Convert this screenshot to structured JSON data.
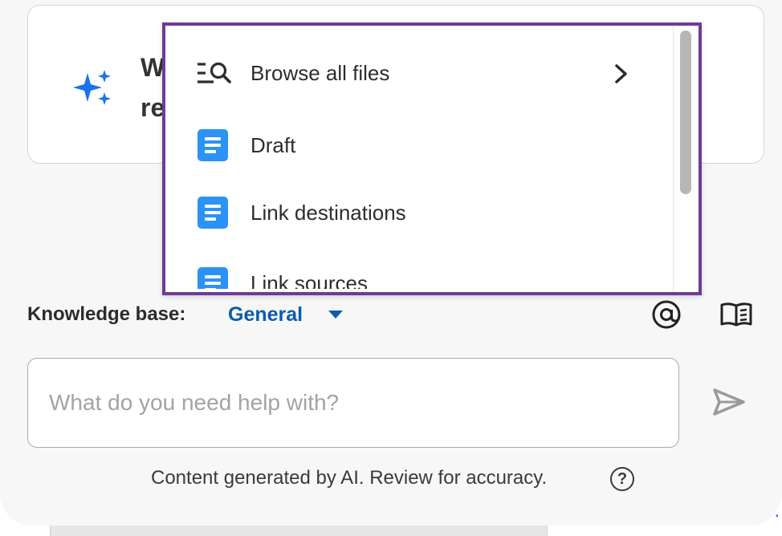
{
  "prompt_card": {
    "text": "W\nre",
    "icon": "sparkle-icon"
  },
  "dropdown": {
    "items": [
      {
        "label": "Browse all files",
        "icon": "browse-search-icon",
        "has_chevron": true
      },
      {
        "label": "Draft",
        "icon": "document-icon"
      },
      {
        "label": "Link destinations",
        "icon": "document-icon"
      },
      {
        "label": "Link sources",
        "icon": "document-icon"
      }
    ]
  },
  "knowledge_base": {
    "label": "Knowledge base:",
    "value": "General"
  },
  "input": {
    "placeholder": "What do you need help with?",
    "value": ""
  },
  "footer": {
    "disclaimer": "Content generated by AI. Review for accuracy.",
    "help": "?"
  },
  "colors": {
    "accent": "#0b5cad",
    "dropdown_border": "#6f3a97",
    "doc_icon": "#2a93f5",
    "sparkle": "#1a73e8"
  }
}
